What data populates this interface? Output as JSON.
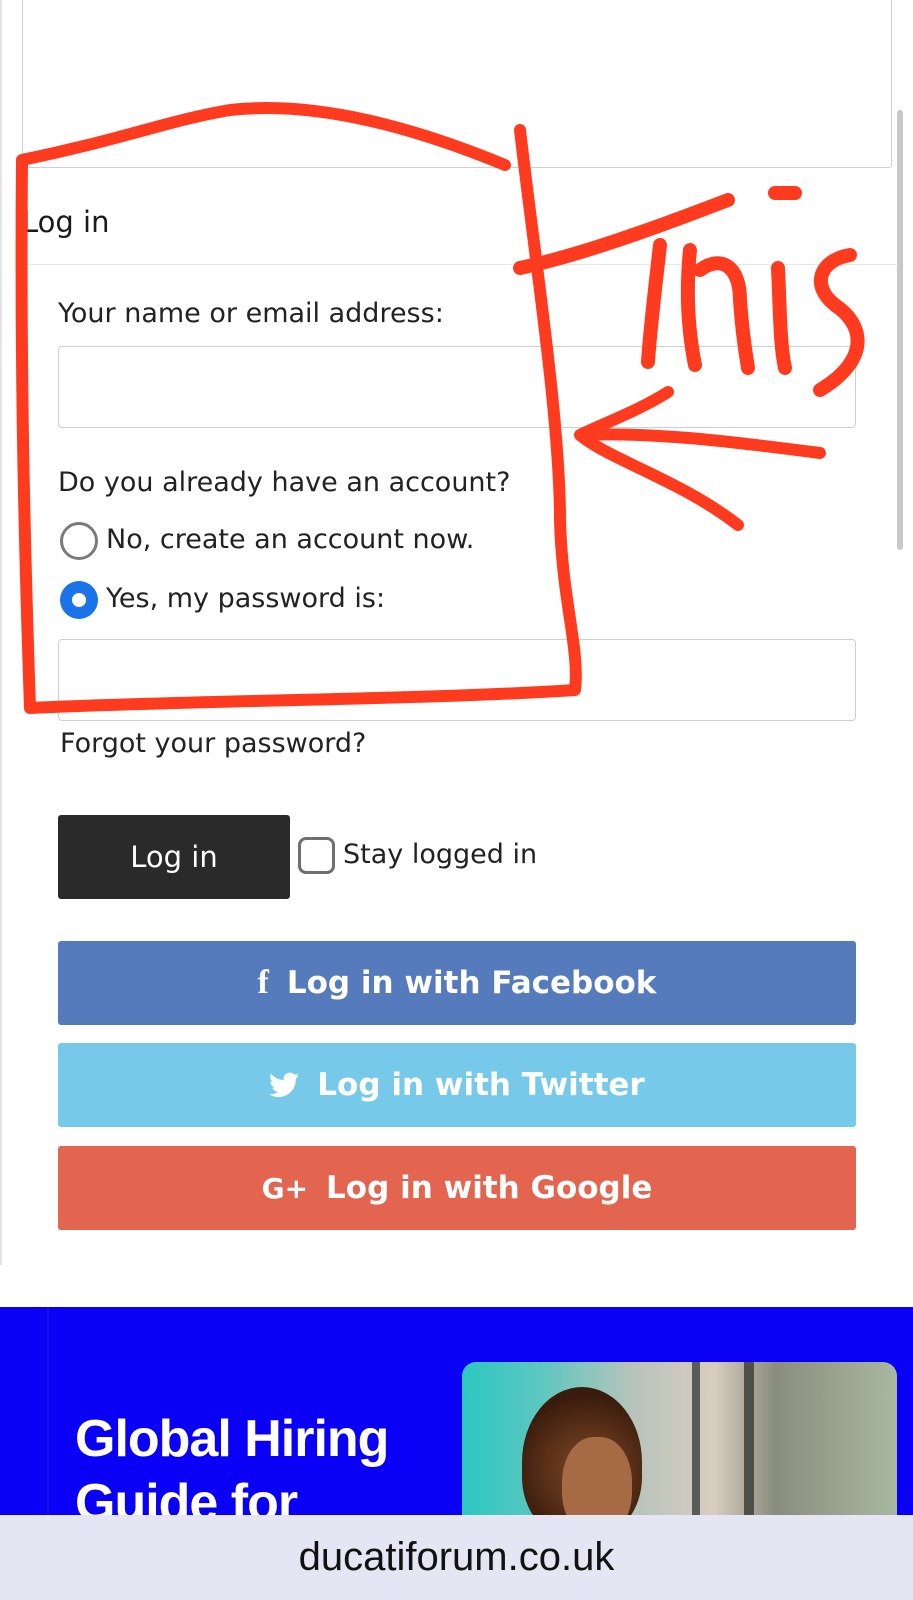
{
  "form": {
    "block_title": "Log in",
    "name_label": "Your name or email address:",
    "name_value": "",
    "account_question": "Do you already have an account?",
    "option_no": "No, create an account now.",
    "option_yes": "Yes, my password is:",
    "password_value": "",
    "forgot_link": "Forgot your password?",
    "login_button": "Log in",
    "stay_logged_in": "Stay logged in"
  },
  "social": {
    "facebook_label": "Log in with Facebook",
    "twitter_label": "Log in with Twitter",
    "google_label": "Log in with Google",
    "facebook_icon": "f",
    "google_icon": "G+",
    "colors": {
      "facebook": "#567bbd",
      "twitter": "#77c9ea",
      "google": "#e4654f"
    }
  },
  "ad": {
    "headline_line1": "Global Hiring",
    "headline_line2": "Guide for",
    "background": "#0a00f5"
  },
  "browser": {
    "url": "ducatiforum.co.uk"
  },
  "annotation": {
    "text": "This",
    "color": "#ff3b1f"
  }
}
